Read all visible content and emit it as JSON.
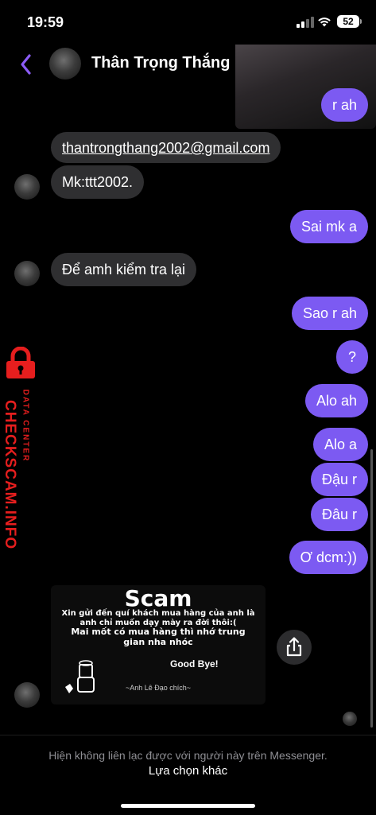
{
  "status_bar": {
    "time": "19:59",
    "battery": "52"
  },
  "header": {
    "contact_name": "Thân Trọng Thắng"
  },
  "messages": [
    {
      "text": "r ah"
    },
    {
      "text": "thantrongthang2002@gmail.com"
    },
    {
      "text": "Mk:ttt2002."
    },
    {
      "text": "Sai mk a"
    },
    {
      "text": "Để amh kiểm tra lại"
    },
    {
      "text": "Sao r ah"
    },
    {
      "text": "?"
    },
    {
      "text": "Alo ah"
    },
    {
      "text": "Alo a"
    },
    {
      "text": "Đậu r"
    },
    {
      "text": "Đâu r"
    },
    {
      "text": "Ơ dcm:))"
    }
  ],
  "watermark": {
    "brand": "CHECKSCAM.INFO",
    "sub": "DATA CENTER"
  },
  "scam_image": {
    "title": "Scam",
    "line1": "Xin gửi đến quí khách mua hàng của anh là",
    "line2": "anh chỉ muốn dạy mày ra đời thôi:(",
    "line3": "Mai mốt có mua hàng thì nhớ trung",
    "line4": "gian nha nhóc",
    "bye": "Good Bye!",
    "sign": "~Anh Lê Đạo chích~"
  },
  "footer": {
    "note": "Hiện không liên lạc được với người này trên Messenger.",
    "link": "Lựa chọn khác"
  },
  "colors": {
    "outgoing_bubble": "#7c5af2",
    "incoming_bubble": "#2f2f31",
    "accent": "#8b5cf6"
  }
}
